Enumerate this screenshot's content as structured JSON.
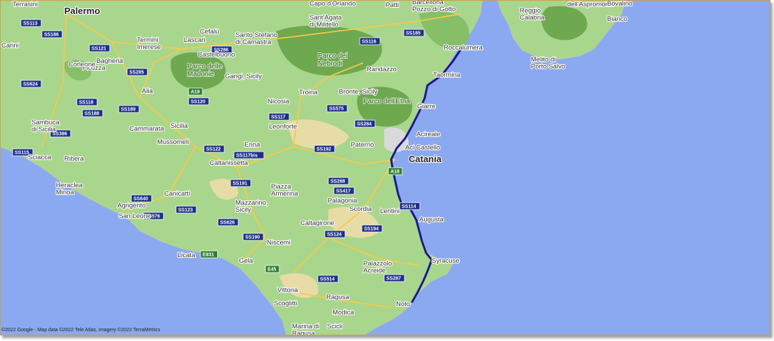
{
  "colors": {
    "sea": "#8aa9f0",
    "land": "#a9d68d",
    "park": "#6ea84f",
    "urban": "#d9d9d9",
    "route": "#1a1a8c",
    "road": "#f7c948",
    "shield": "#1d2f8a"
  },
  "route_label": "Catania to Syracuse coastal route",
  "places": [
    {
      "name": "Terrasini",
      "cls": "mid"
    },
    {
      "name": "Palermo",
      "cls": "big"
    },
    {
      "name": "Bagheria",
      "cls": "mid"
    },
    {
      "name": "Carini",
      "cls": "mid"
    },
    {
      "name": "Ficuzza",
      "cls": "mid"
    },
    {
      "name": "Corleone",
      "cls": "mid"
    },
    {
      "name": "Sambuca di Sicilia",
      "cls": "mid"
    },
    {
      "name": "Sciacca",
      "cls": "mid"
    },
    {
      "name": "Ribera",
      "cls": "mid"
    },
    {
      "name": "Heraclea Minoa",
      "cls": "mid"
    },
    {
      "name": "Agrigento",
      "cls": "mid"
    },
    {
      "name": "San Leone",
      "cls": "mid"
    },
    {
      "name": "Termini Imerese",
      "cls": "mid"
    },
    {
      "name": "Cefalù",
      "cls": "mid"
    },
    {
      "name": "Lascari",
      "cls": "mid"
    },
    {
      "name": "Castelbuono",
      "cls": "mid"
    },
    {
      "name": "Gangi, Sicily",
      "cls": "mid"
    },
    {
      "name": "Alia",
      "cls": "mid"
    },
    {
      "name": "Cammarata",
      "cls": "mid"
    },
    {
      "name": "Mussomeli",
      "cls": "mid"
    },
    {
      "name": "Sicilia",
      "cls": "mid"
    },
    {
      "name": "Caltanissetta",
      "cls": "mid"
    },
    {
      "name": "Canicattì",
      "cls": "mid"
    },
    {
      "name": "Licata",
      "cls": "mid"
    },
    {
      "name": "Gela",
      "cls": "mid"
    },
    {
      "name": "Niscemi",
      "cls": "mid"
    },
    {
      "name": "Mazzarino, Sicily",
      "cls": "mid"
    },
    {
      "name": "Piazza Armerina",
      "cls": "mid"
    },
    {
      "name": "Enna",
      "cls": "mid"
    },
    {
      "name": "Leonforte",
      "cls": "mid"
    },
    {
      "name": "Nicosia",
      "cls": "mid"
    },
    {
      "name": "Troina",
      "cls": "mid"
    },
    {
      "name": "Santo Stefano di Camastra",
      "cls": "mid"
    },
    {
      "name": "Sant'Agata di Militello",
      "cls": "mid"
    },
    {
      "name": "Capo d'Orlando",
      "cls": "mid"
    },
    {
      "name": "Patti",
      "cls": "mid"
    },
    {
      "name": "Barcellona Pozzo di Gotto",
      "cls": "mid"
    },
    {
      "name": "Randazzo",
      "cls": "mid"
    },
    {
      "name": "Bronte, Sicily",
      "cls": "mid"
    },
    {
      "name": "Roccalumera",
      "cls": "mid"
    },
    {
      "name": "Taormina",
      "cls": "mid"
    },
    {
      "name": "Giarre",
      "cls": "mid"
    },
    {
      "name": "Acireale",
      "cls": "mid"
    },
    {
      "name": "Aci Castello",
      "cls": "mid"
    },
    {
      "name": "Catania",
      "cls": "big"
    },
    {
      "name": "Paternò",
      "cls": "mid"
    },
    {
      "name": "Palagonia",
      "cls": "mid"
    },
    {
      "name": "Scordia",
      "cls": "mid"
    },
    {
      "name": "Lentini",
      "cls": "mid"
    },
    {
      "name": "Augusta",
      "cls": "mid"
    },
    {
      "name": "Caltagirone",
      "cls": "mid"
    },
    {
      "name": "Palazzolo Acreide",
      "cls": "mid"
    },
    {
      "name": "Syracuse",
      "cls": "mid"
    },
    {
      "name": "Vittoria",
      "cls": "mid"
    },
    {
      "name": "Ragusa",
      "cls": "mid"
    },
    {
      "name": "Scoglitti",
      "cls": "mid"
    },
    {
      "name": "Modica",
      "cls": "mid"
    },
    {
      "name": "Noto",
      "cls": "mid"
    },
    {
      "name": "Scicli",
      "cls": "mid"
    },
    {
      "name": "Marina di Ragusa",
      "cls": "mid"
    },
    {
      "name": "Reggio Calabria",
      "cls": "mid"
    },
    {
      "name": "Melito di Porto Salvo",
      "cls": "mid"
    },
    {
      "name": "dell'Aspromonte",
      "cls": "mid"
    },
    {
      "name": "Bovalino",
      "cls": "mid"
    },
    {
      "name": "Bianco",
      "cls": "mid"
    }
  ],
  "parks": [
    {
      "name": "Parco delle Madonie"
    },
    {
      "name": "Parco dei Nebrodi"
    },
    {
      "name": "Parco dell'Etna"
    }
  ],
  "shields": [
    {
      "label": "SS113",
      "type": "ss"
    },
    {
      "label": "SS186",
      "type": "ss"
    },
    {
      "label": "SS121",
      "type": "ss"
    },
    {
      "label": "SS285",
      "type": "ss"
    },
    {
      "label": "SS624",
      "type": "ss"
    },
    {
      "label": "SS118",
      "type": "ss"
    },
    {
      "label": "SS188",
      "type": "ss"
    },
    {
      "label": "SS386",
      "type": "ss"
    },
    {
      "label": "SS115",
      "type": "ss"
    },
    {
      "label": "SS189",
      "type": "ss"
    },
    {
      "label": "SS640",
      "type": "ss"
    },
    {
      "label": "SS576",
      "type": "ss"
    },
    {
      "label": "SS123",
      "type": "ss"
    },
    {
      "label": "SS626",
      "type": "ss"
    },
    {
      "label": "SS190",
      "type": "ss"
    },
    {
      "label": "SS191",
      "type": "ss"
    },
    {
      "label": "SS122",
      "type": "ss"
    },
    {
      "label": "SS117bis",
      "type": "ss"
    },
    {
      "label": "SS117",
      "type": "ss"
    },
    {
      "label": "SS120",
      "type": "ss"
    },
    {
      "label": "SS286",
      "type": "ss"
    },
    {
      "label": "SS116",
      "type": "ss"
    },
    {
      "label": "SS185",
      "type": "ss"
    },
    {
      "label": "SS575",
      "type": "ss"
    },
    {
      "label": "SS284",
      "type": "ss"
    },
    {
      "label": "SS192",
      "type": "ss"
    },
    {
      "label": "SS288",
      "type": "ss"
    },
    {
      "label": "SS417",
      "type": "ss"
    },
    {
      "label": "SS114",
      "type": "ss"
    },
    {
      "label": "SS194",
      "type": "ss"
    },
    {
      "label": "SS124",
      "type": "ss"
    },
    {
      "label": "SS514",
      "type": "ss"
    },
    {
      "label": "SS287",
      "type": "ss"
    },
    {
      "label": "A19",
      "type": "e"
    },
    {
      "label": "A18",
      "type": "e"
    },
    {
      "label": "E931",
      "type": "e"
    },
    {
      "label": "E45",
      "type": "e"
    }
  ],
  "copyright": "©2022 Google - Map data ©2022 Tele Atlas, Imagery ©2022 TerraMetrics"
}
